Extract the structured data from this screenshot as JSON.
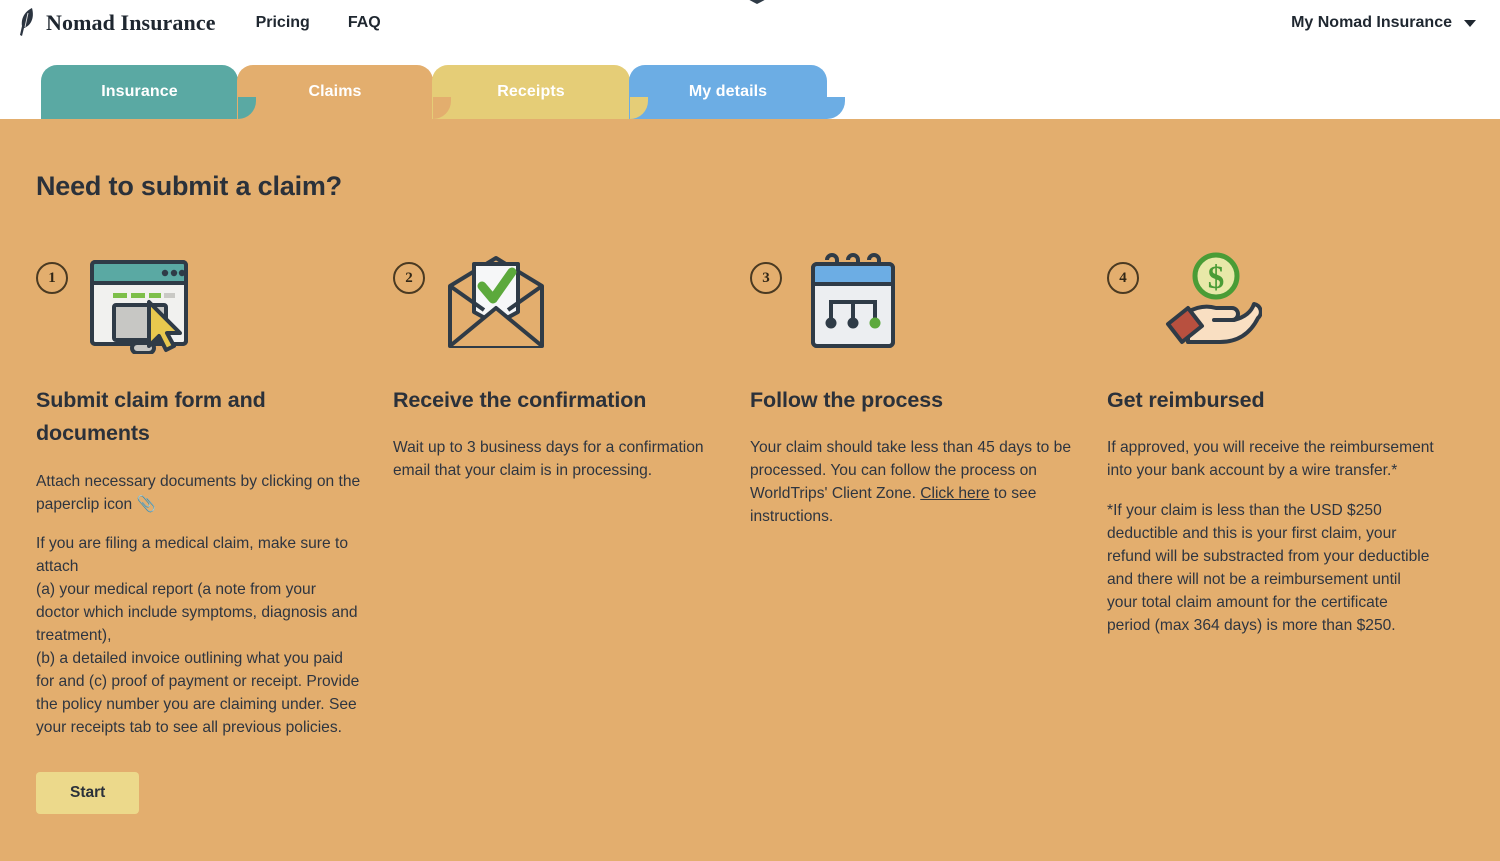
{
  "header": {
    "brand_name": "Nomad Insurance",
    "brand_icon": "feather-icon",
    "nav": [
      {
        "label": "Pricing",
        "name": "nav-link-pricing"
      },
      {
        "label": "FAQ",
        "name": "nav-link-faq"
      }
    ],
    "account_label": "My Nomad Insurance",
    "account_caret_icon": "chevron-down-icon"
  },
  "tabs": [
    {
      "label": "Insurance",
      "color": "#5aa9a3",
      "active": false
    },
    {
      "label": "Claims",
      "color": "#e3ae6e",
      "active": true
    },
    {
      "label": "Receipts",
      "color": "#e5cd77",
      "active": false
    },
    {
      "label": "My details",
      "color": "#6cade4",
      "active": false
    }
  ],
  "main": {
    "title": "Need to submit a claim?",
    "background_color": "#e3ae6e",
    "steps": [
      {
        "number": "1",
        "icon": "browser-form-cursor-icon",
        "title": "Submit claim form and documents",
        "paragraphs": [
          "Attach necessary documents by clicking on the paperclip icon 📎",
          "If you are filing a medical claim, make sure to attach",
          "(a) your medical report (a note from your doctor which include symptoms, diagnosis and treatment),",
          "(b) a detailed invoice outlining what you paid for and (c) proof of payment or receipt. Provide the policy number you are claiming under. See your receipts tab to see all previous policies."
        ],
        "button": {
          "label": "Start",
          "color": "#ecd98b"
        }
      },
      {
        "number": "2",
        "icon": "envelope-check-icon",
        "title": "Receive the confirmation",
        "paragraphs": [
          "Wait up to 3 business days for a confirmation email that your claim is in processing."
        ]
      },
      {
        "number": "3",
        "icon": "calendar-process-icon",
        "title": "Follow the process",
        "paragraphs": [
          "Your claim should take less than 45 days to be processed. You can follow the process on WorldTrips' Client Zone."
        ],
        "link_text": "Click here",
        "link_suffix": " to see instructions."
      },
      {
        "number": "4",
        "icon": "hand-coin-icon",
        "title": "Get reimbursed",
        "paragraphs": [
          "If approved, you will receive the reimbursement into your bank account by a wire transfer.*"
        ],
        "footnote": "*If your claim is less than the USD $250 deductible and this is your first claim, your refund will be substracted from your deductible and there will not be a reimbursement until your total claim amount for the certificate period (max 364 days) is more than $250."
      }
    ]
  }
}
